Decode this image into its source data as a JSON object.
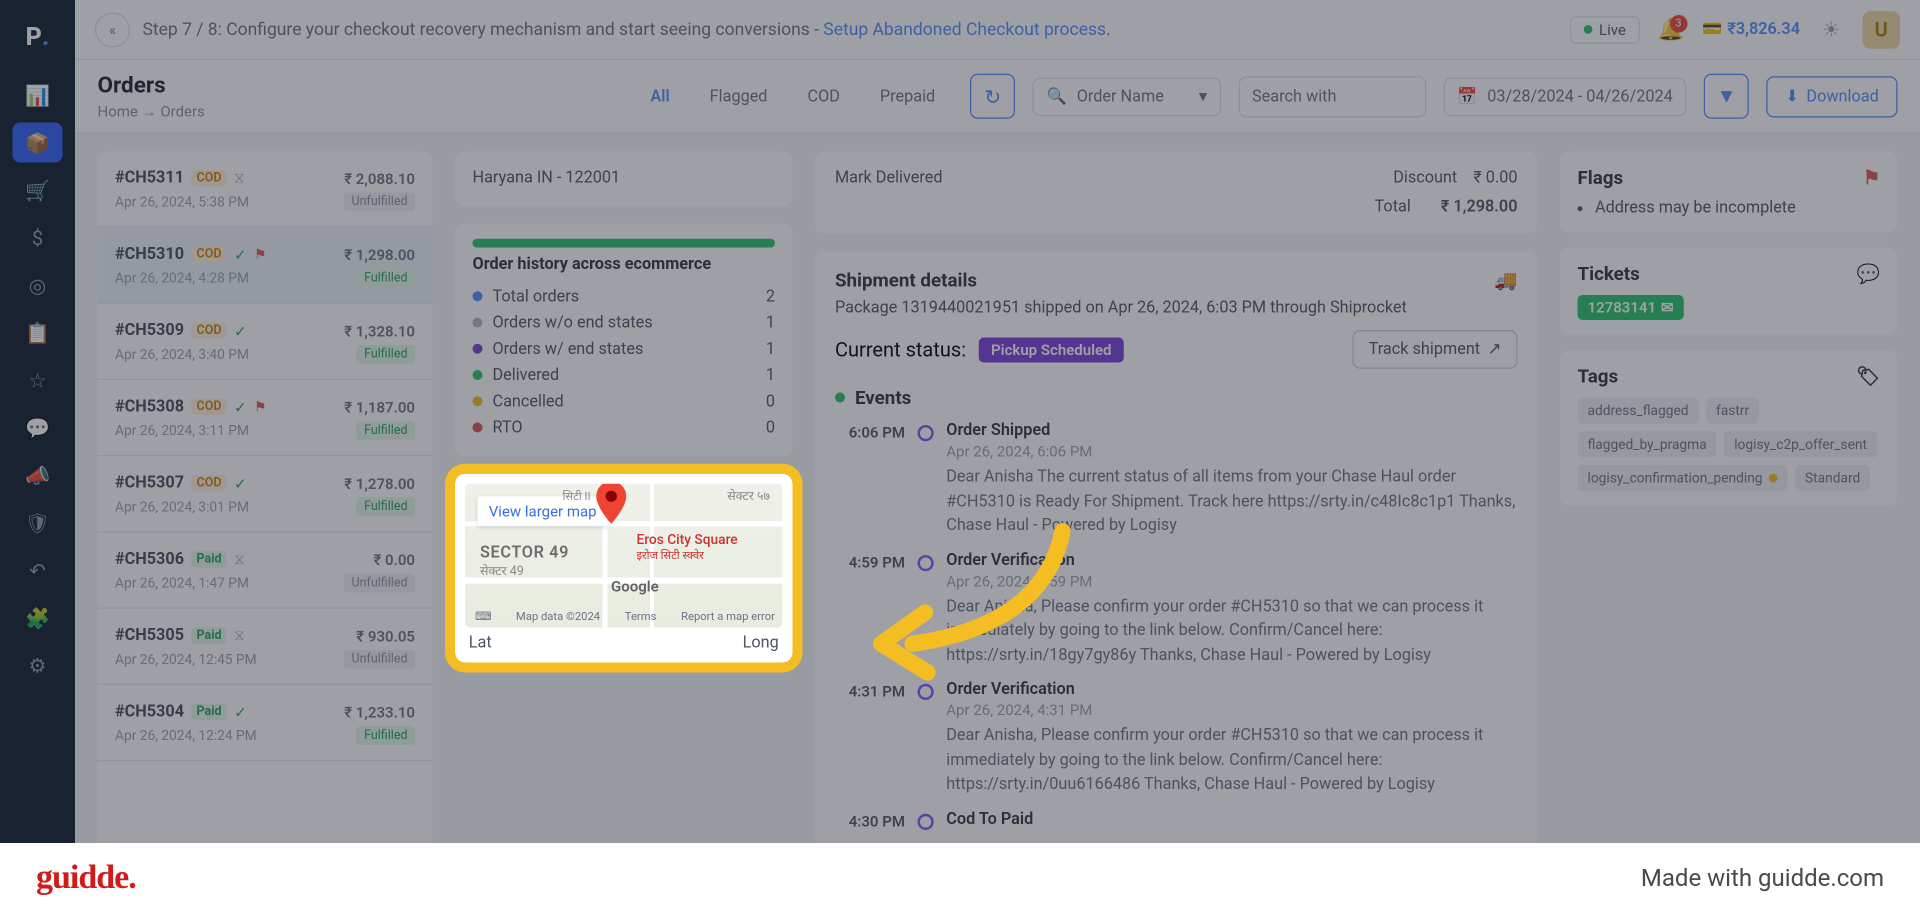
{
  "banner": {
    "step": "Step 7 / 8: Configure your checkout recovery mechanism and start seeing conversions - ",
    "link": "Setup Abandoned Checkout process",
    "live": "Live",
    "bell_count": "3",
    "wallet": "₹3,826.34",
    "avatar": "U"
  },
  "header": {
    "title": "Orders",
    "crumb1": "Home",
    "crumb2": "Orders",
    "tabs": {
      "all": "All",
      "flagged": "Flagged",
      "cod": "COD",
      "prepaid": "Prepaid"
    },
    "order_name": "Order Name",
    "search_ph": "Search with",
    "dates": "03/28/2024 - 04/26/2024",
    "download": "Download"
  },
  "orders": [
    {
      "id": "#CH5311",
      "pay": "COD",
      "icons": "hr",
      "amt": "₹ 2,088.10",
      "date": "Apr 26, 2024, 5:38 PM",
      "status": "Unfulfilled"
    },
    {
      "id": "#CH5310",
      "pay": "COD",
      "icons": "ck flg",
      "amt": "₹ 1,298.00",
      "date": "Apr 26, 2024, 4:28 PM",
      "status": "Fulfilled",
      "sel": true
    },
    {
      "id": "#CH5309",
      "pay": "COD",
      "icons": "ck",
      "amt": "₹ 1,328.10",
      "date": "Apr 26, 2024, 3:40 PM",
      "status": "Fulfilled"
    },
    {
      "id": "#CH5308",
      "pay": "COD",
      "icons": "ck flg",
      "amt": "₹ 1,187.00",
      "date": "Apr 26, 2024, 3:11 PM",
      "status": "Fulfilled"
    },
    {
      "id": "#CH5307",
      "pay": "COD",
      "icons": "ck",
      "amt": "₹ 1,278.00",
      "date": "Apr 26, 2024, 3:01 PM",
      "status": "Fulfilled"
    },
    {
      "id": "#CH5306",
      "pay": "Paid",
      "icons": "hr",
      "amt": "₹ 0.00",
      "date": "Apr 26, 2024, 1:47 PM",
      "status": "Unfulfilled"
    },
    {
      "id": "#CH5305",
      "pay": "Paid",
      "icons": "hr",
      "amt": "₹ 930.05",
      "date": "Apr 26, 2024, 12:45 PM",
      "status": "Unfulfilled"
    },
    {
      "id": "#CH5304",
      "pay": "Paid",
      "icons": "ck",
      "amt": "₹ 1,233.10",
      "date": "Apr 26, 2024, 12:24 PM",
      "status": "Fulfilled"
    }
  ],
  "addr": "Haryana IN - 122001",
  "history": {
    "title": "Order history across ecommerce",
    "rows": [
      {
        "c": "#4f8cff",
        "l": "Total orders",
        "v": "2"
      },
      {
        "c": "#b5b8c0",
        "l": "Orders w/o end states",
        "v": "1"
      },
      {
        "c": "#7a3cdc",
        "l": "Orders w/ end states",
        "v": "1"
      },
      {
        "c": "#24c46a",
        "l": "Delivered",
        "v": "1"
      },
      {
        "c": "#f5bd24",
        "l": "Cancelled",
        "v": "0"
      },
      {
        "c": "#e05252",
        "l": "RTO",
        "v": "0"
      }
    ]
  },
  "map": {
    "vlm": "View larger map",
    "sector": "SECTOR 49",
    "sector2": "सेक्टर 49",
    "eros": "Eros City Square",
    "eros2": "इरोज सिटी स्क्वेर",
    "top": "सेक्टर ५७",
    "top2": "सिटी II",
    "glogo": "Google",
    "kb": "⌨",
    "md": "Map data ©2024",
    "tm": "Terms",
    "re": "Report a map error",
    "lat": "Lat",
    "long": "Long"
  },
  "detail": {
    "mark": "Mark Delivered",
    "disc_l": "Discount",
    "disc_v": "₹ 0.00",
    "tot_l": "Total",
    "tot_v": "₹ 1,298.00",
    "ship_h": "Shipment details",
    "ship_sub": "Package 1319440021951 shipped on Apr 26, 2024, 6:03 PM through Shiprocket",
    "cur": "Current status:",
    "pill": "Pickup Scheduled",
    "track": "Track shipment",
    "events": "Events"
  },
  "events": [
    {
      "t": "6:06 PM",
      "h": "Order Shipped",
      "d": "Apr 26, 2024, 6:06 PM",
      "body": "Dear Anisha The current status of all items from your Chase Haul order #CH5310 is Ready For Shipment. Track here https://srty.in/c48Ic8c1p1 Thanks, Chase Haul - Powered by Logisy"
    },
    {
      "t": "4:59 PM",
      "h": "Order Verification",
      "d": "Apr 26, 2024, 4:59 PM",
      "body": "Dear Anisha, Please confirm your order #CH5310 so that we can process it immediately by going to the link below. Confirm/Cancel here: https://srty.in/18gy7gy86y Thanks, Chase Haul - Powered by Logisy"
    },
    {
      "t": "4:31 PM",
      "h": "Order Verification",
      "d": "Apr 26, 2024, 4:31 PM",
      "body": "Dear Anisha, Please confirm your order #CH5310 so that we can process it immediately by going to the link below. Confirm/Cancel here: https://srty.in/0uu6166486 Thanks, Chase Haul - Powered by Logisy"
    },
    {
      "t": "4:30 PM",
      "h": "Cod To Paid",
      "d": "",
      "body": ""
    }
  ],
  "side": {
    "flags_h": "Flags",
    "flag1": "Address may be incomplete",
    "tickets_h": "Tickets",
    "ticket": "12783141",
    "tags_h": "Tags",
    "tags": [
      "address_flagged",
      "fastrr",
      "flagged_by_pragma",
      "logisy_c2p_offer_sent"
    ],
    "tag_y": "logisy_confirmation_pending",
    "tag_std": "Standard"
  },
  "footer": {
    "brand": "guidde.",
    "made": "Made with guidde.com"
  }
}
